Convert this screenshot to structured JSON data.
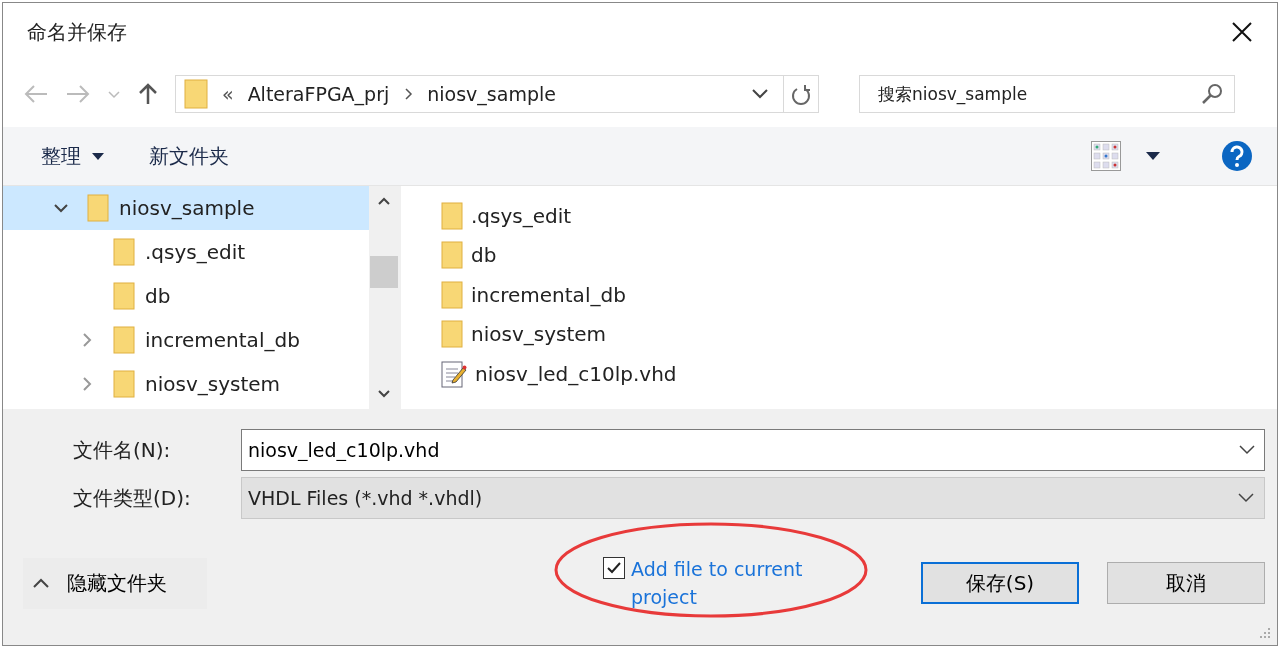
{
  "window": {
    "title": "命名并保存"
  },
  "nav": {
    "path_overflow": "«",
    "breadcrumbs": [
      "AlteraFPGA_prj",
      "niosv_sample"
    ],
    "search": {
      "placeholder": "搜索niosv_sample"
    }
  },
  "toolbar": {
    "organize": "整理",
    "new_folder": "新文件夹"
  },
  "tree": [
    {
      "label": "niosv_sample",
      "selected": true,
      "expanded": true,
      "children": [
        {
          "label": ".qsys_edit",
          "selected": false
        },
        {
          "label": "db",
          "selected": false
        },
        {
          "label": "incremental_db",
          "selected": false,
          "expanded": false
        },
        {
          "label": "niosv_system",
          "selected": false,
          "expanded": false
        }
      ]
    }
  ],
  "files": [
    {
      "name": ".qsys_edit",
      "kind": "folder"
    },
    {
      "name": "db",
      "kind": "folder"
    },
    {
      "name": "incremental_db",
      "kind": "folder"
    },
    {
      "name": "niosv_system",
      "kind": "folder"
    },
    {
      "name": "niosv_led_c10lp.vhd",
      "kind": "file"
    }
  ],
  "form": {
    "filename_label": "文件名(N):",
    "filename": "niosv_led_c10lp.vhd",
    "type_label": "文件类型(D):",
    "type": "VHDL Files (*.vhd *.vhdl)"
  },
  "add_to_project": {
    "label": "Add file to current project",
    "checked": true
  },
  "hide_folders": "隐藏文件夹",
  "buttons": [
    {
      "label": "保存(S)",
      "kind": "default"
    },
    {
      "label": "取消",
      "kind": "normal"
    }
  ]
}
